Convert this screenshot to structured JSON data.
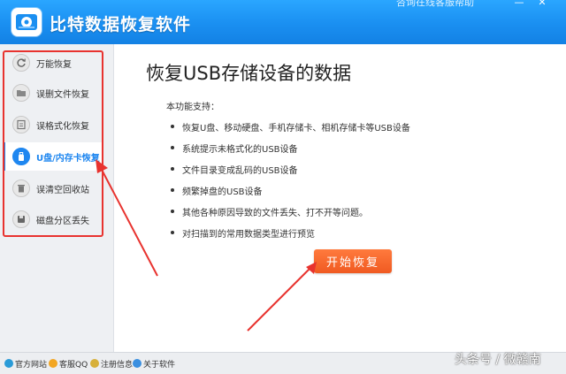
{
  "header": {
    "app_title": "比特数据恢复软件",
    "link_text": "咨询在线客服帮助",
    "controls": [
      "—",
      "✕"
    ],
    "accent_color": "#1a8ff1"
  },
  "sidebar": {
    "items": [
      {
        "label": "万能恢复",
        "icon": "refresh-icon"
      },
      {
        "label": "误删文件恢复",
        "icon": "folder-icon"
      },
      {
        "label": "误格式化恢复",
        "icon": "format-icon"
      },
      {
        "label": "U盘/内存卡恢复",
        "icon": "usb-icon",
        "active": true
      },
      {
        "label": "误清空回收站",
        "icon": "trash-icon"
      },
      {
        "label": "磁盘分区丢失",
        "icon": "disk-icon"
      }
    ]
  },
  "main": {
    "title": "恢复USB存储设备的数据",
    "intro": "本功能支持：",
    "features": [
      "恢复U盘、移动硬盘、手机存储卡、相机存储卡等USB设备",
      "系统提示未格式化的USB设备",
      "文件目录变成乱码的USB设备",
      "频繁掉盘的USB设备",
      "其他各种原因导致的文件丢失、打不开等问题。",
      "对扫描到的常用数据类型进行预览"
    ],
    "start_button": "开始恢复",
    "button_color": "#f05a22"
  },
  "statusbar": {
    "items": [
      {
        "label": "官方网站",
        "icon": "globe-icon"
      },
      {
        "label": "客服QQ",
        "icon": "qq-icon"
      },
      {
        "label": "注册信息",
        "icon": "key-icon"
      },
      {
        "label": "关于软件",
        "icon": "info-icon"
      }
    ]
  },
  "watermark": "头条号 / 微赣南",
  "annotation_color": "#e8332f"
}
